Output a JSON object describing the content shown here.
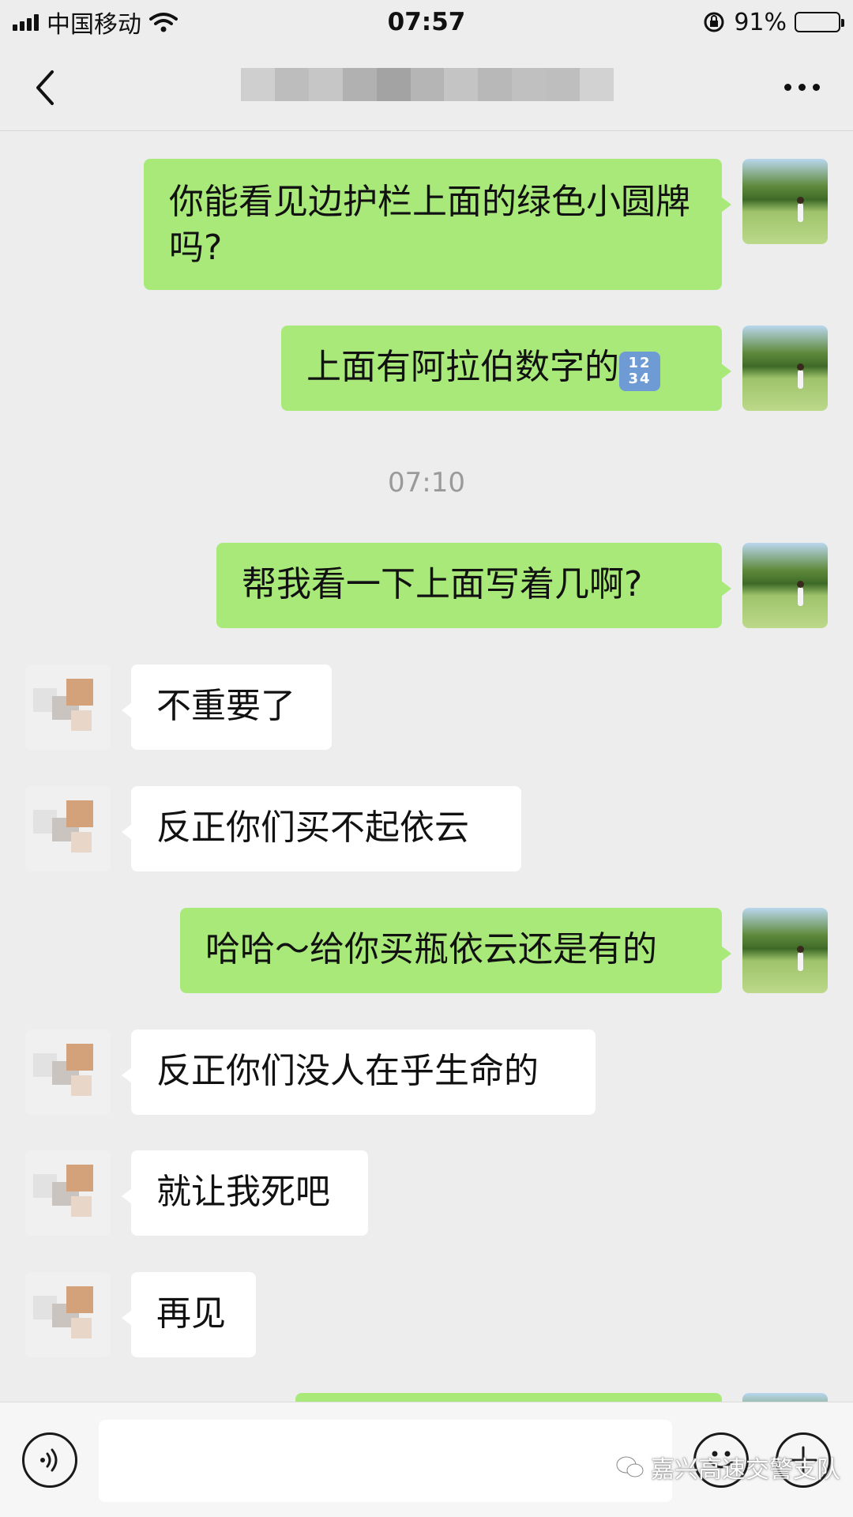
{
  "status_bar": {
    "carrier": "中国移动",
    "time": "07:57",
    "battery_percent": "91%",
    "battery_level": 0.91
  },
  "nav": {
    "back_icon": "chevron-left-icon",
    "more_icon": "ellipsis-icon"
  },
  "messages": [
    {
      "sender": "me",
      "text": "你能看见边护栏上面的绿色小圆牌吗?"
    },
    {
      "sender": "me",
      "text": "上面有阿拉伯数字的",
      "emoji": "1234"
    },
    {
      "type": "timestamp",
      "text": "07:10"
    },
    {
      "sender": "me",
      "text": "帮我看一下上面写着几啊?"
    },
    {
      "sender": "other",
      "text": "不重要了"
    },
    {
      "sender": "other",
      "text": "反正你们买不起依云"
    },
    {
      "sender": "me",
      "text": "哈哈～给你买瓶依云还是有的"
    },
    {
      "sender": "other",
      "text": "反正你们没人在乎生命的"
    },
    {
      "sender": "other",
      "text": "就让我死吧"
    },
    {
      "sender": "other",
      "text": "再见"
    }
  ],
  "input_bar": {
    "voice_icon": "voice-icon",
    "emoji_icon": "smiley-icon",
    "plus_icon": "plus-icon",
    "watermark": "嘉兴高速交警支队"
  },
  "colors": {
    "background": "#ededed",
    "my_bubble": "#a9e97a",
    "other_bubble": "#ffffff"
  }
}
